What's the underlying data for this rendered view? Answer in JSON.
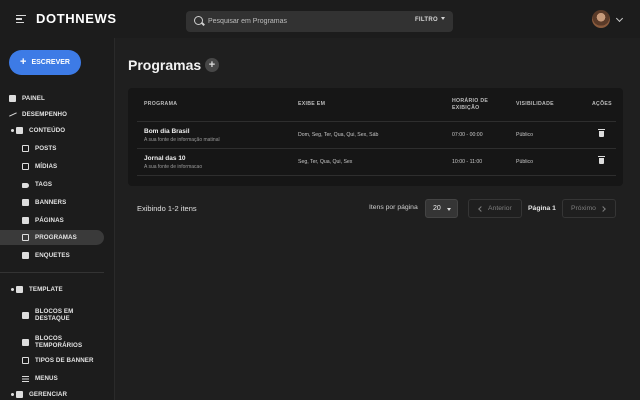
{
  "app": {
    "logo": "DOTHNEWS"
  },
  "search": {
    "placeholder": "Pesquisar em Programas",
    "filter_label": "FILTRO"
  },
  "sidebar": {
    "write_label": "ESCREVER",
    "items": [
      {
        "label": "PAINEL",
        "icon": "dashboard-icon"
      },
      {
        "label": "DESEMPENHO",
        "icon": "trending-icon"
      },
      {
        "label": "CONTEÚDO",
        "icon": "content-icon"
      },
      {
        "label": "POSTS",
        "icon": "posts-icon"
      },
      {
        "label": "MÍDIAS",
        "icon": "media-icon"
      },
      {
        "label": "TAGS",
        "icon": "tag-icon"
      },
      {
        "label": "BANNERS",
        "icon": "banner-icon"
      },
      {
        "label": "PÁGINAS",
        "icon": "pages-icon"
      },
      {
        "label": "PROGRAMAS",
        "icon": "programs-icon"
      },
      {
        "label": "ENQUETES",
        "icon": "poll-icon"
      },
      {
        "label": "TEMPLATE",
        "icon": "template-icon"
      },
      {
        "label": "BLOCOS EM DESTAQUE",
        "icon": "featured-blocks-icon"
      },
      {
        "label": "BLOCOS TEMPORÁRIOS",
        "icon": "temporary-blocks-icon"
      },
      {
        "label": "TIPOS DE BANNER",
        "icon": "banner-types-icon"
      },
      {
        "label": "MENUS",
        "icon": "menus-icon"
      },
      {
        "label": "GERENCIAR",
        "icon": "manage-icon"
      }
    ]
  },
  "page": {
    "title": "Programas"
  },
  "table": {
    "headers": [
      "PROGRAMA",
      "EXIBE EM",
      "HORÁRIO DE EXIBIÇÃO",
      "VISIBILIDADE",
      "AÇÕES"
    ],
    "rows": [
      {
        "title": "Bom dia Brasil",
        "subtitle": "A sua fonte de informação matinal",
        "days": "Dom, Seg, Ter, Qua, Qui, Sex, Sáb",
        "time": "07:00 - 00:00",
        "visibility": "Público"
      },
      {
        "title": "Jornal das 10",
        "subtitle": "A sua fonte de informacao",
        "days": "Seg, Ter, Qua, Qui, Sex",
        "time": "10:00 - 11:00",
        "visibility": "Público"
      }
    ]
  },
  "footer": {
    "count": "Exibindo 1-2 itens",
    "items_per_page_label": "Itens por página",
    "items_per_page": "20",
    "prev": "Anterior",
    "page": "Página 1",
    "next": "Próximo"
  }
}
